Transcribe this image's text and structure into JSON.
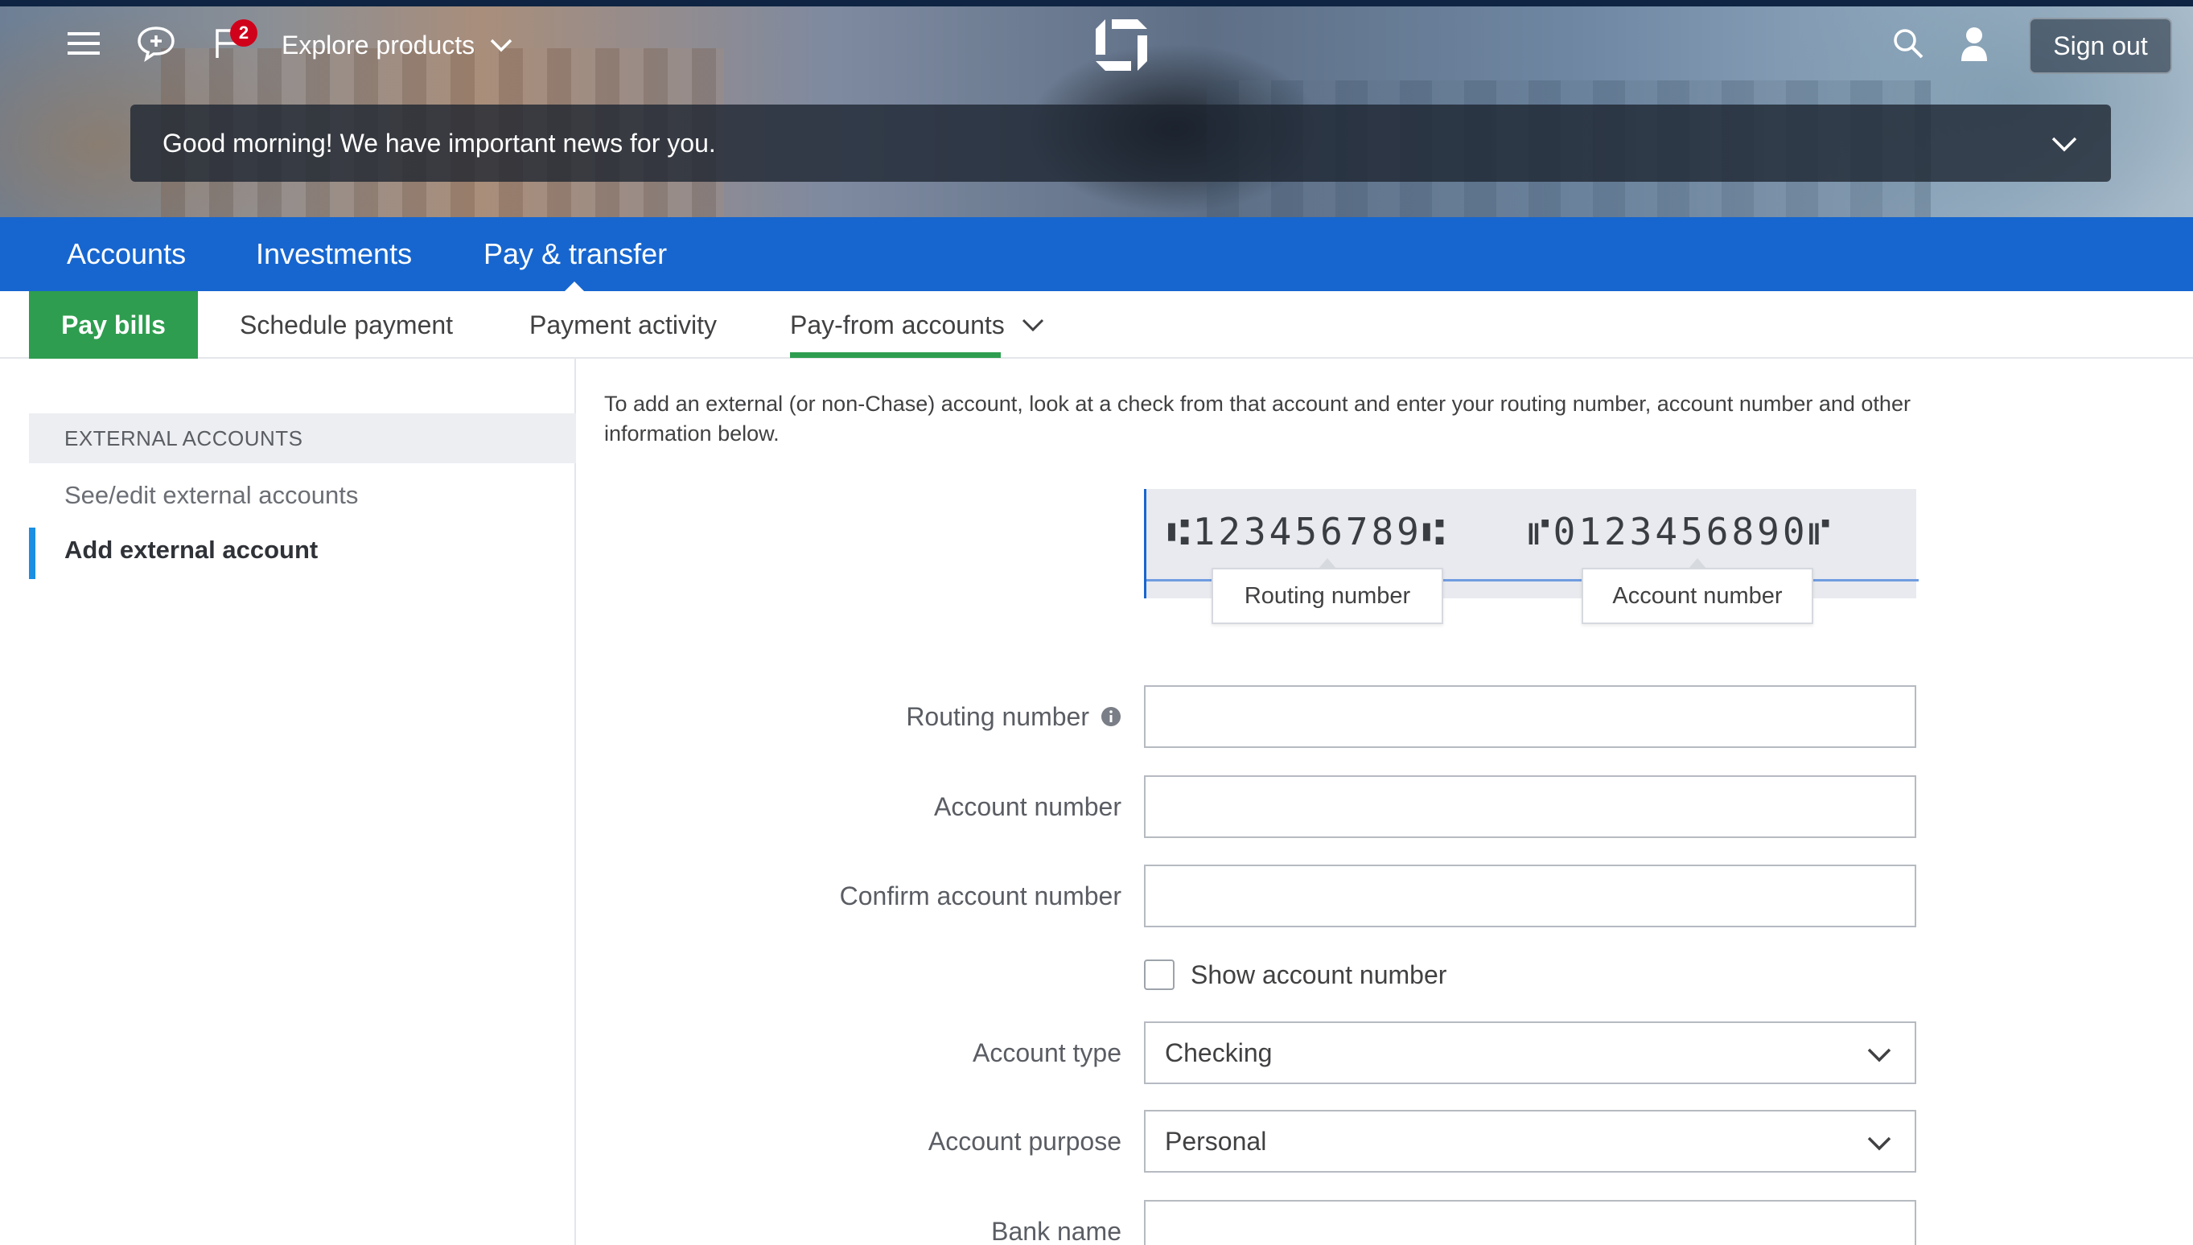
{
  "header": {
    "notifications_count": "2",
    "explore_label": "Explore products",
    "signout_label": "Sign out",
    "news_message": "Good morning! We have important news for you."
  },
  "primary_nav": {
    "items": [
      "Accounts",
      "Investments",
      "Pay & transfer"
    ],
    "active": "Pay & transfer"
  },
  "secondary_nav": {
    "items": [
      "Pay bills",
      "Schedule payment",
      "Payment activity",
      "Pay-from accounts"
    ],
    "highlighted": "Pay bills",
    "selected": "Pay-from accounts"
  },
  "sidebar": {
    "heading": "EXTERNAL ACCOUNTS",
    "links": [
      "See/edit external accounts",
      "Add external account"
    ],
    "active": "Add external account"
  },
  "main": {
    "intro": "To add an external (or non-Chase) account, look at a check from that account and enter your routing number, account number and other information below.",
    "check": {
      "routing_micr": "⑆123456789⑆",
      "account_micr": "⑈0123456890⑈",
      "routing_callout": "Routing number",
      "account_callout": "Account number"
    },
    "form": {
      "routing_label": "Routing number",
      "routing_value": "",
      "account_label": "Account number",
      "account_value": "",
      "confirm_label": "Confirm account number",
      "confirm_value": "",
      "show_account_label": "Show account number",
      "show_account_checked": false,
      "type_label": "Account type",
      "type_value": "Checking",
      "purpose_label": "Account purpose",
      "purpose_value": "Personal",
      "bank_label": "Bank name",
      "bank_value": ""
    }
  },
  "colors": {
    "primary_blue": "#1766cf",
    "green": "#2e9d4f",
    "active_accent": "#1a8fe3",
    "badge_red": "#d0021b"
  },
  "icons": [
    "menu-icon",
    "chat-icon",
    "flag-icon",
    "chevron-down-icon",
    "chase-logo-icon",
    "search-icon",
    "user-icon",
    "info-icon"
  ]
}
